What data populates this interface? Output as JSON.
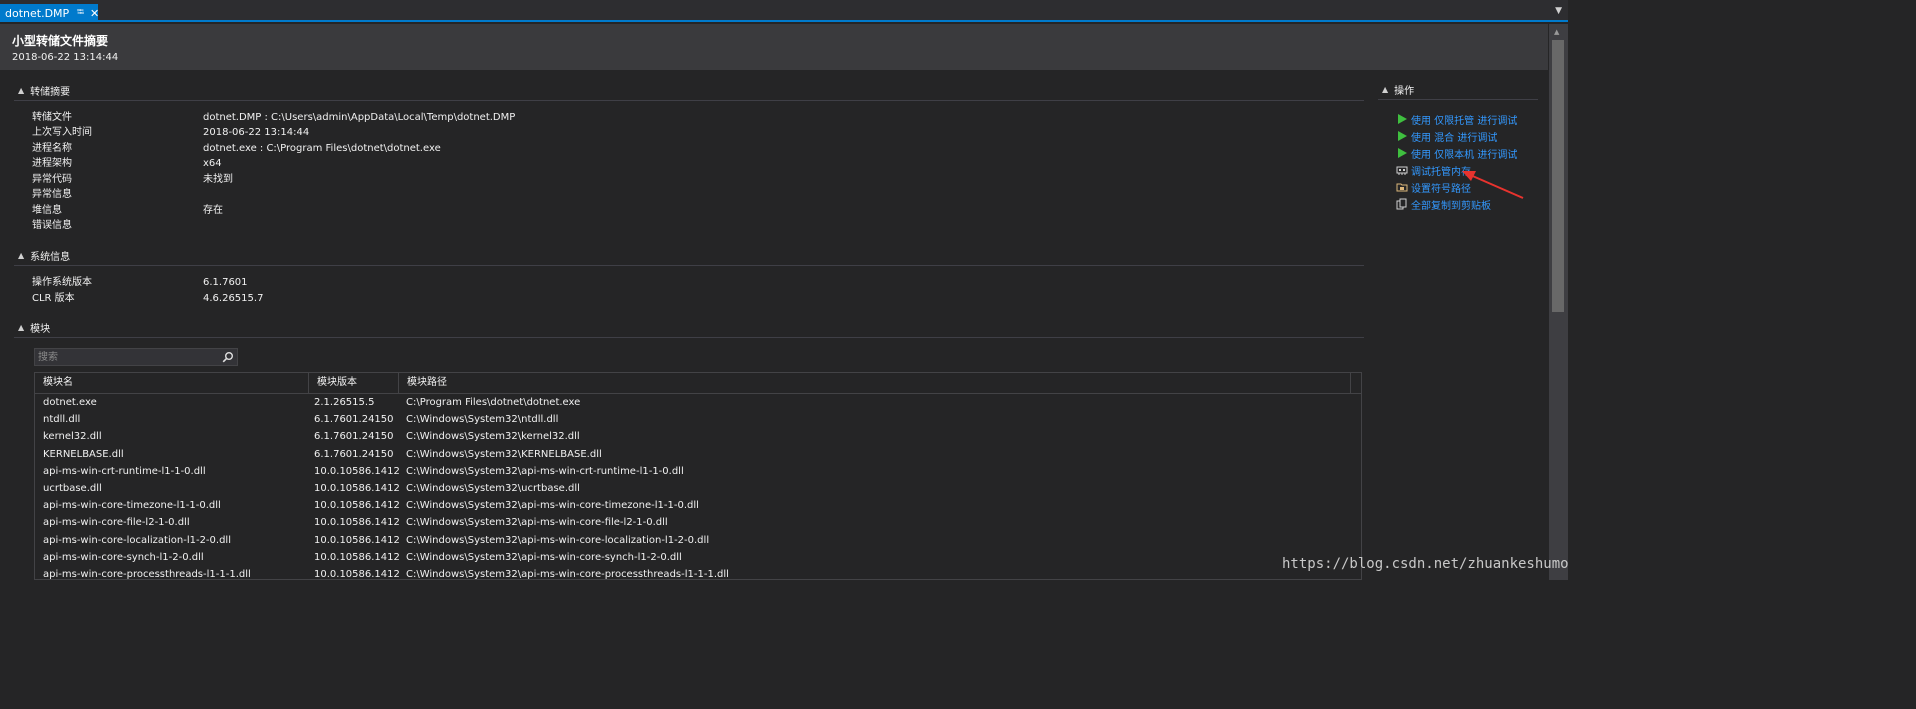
{
  "tab": {
    "label": "dotnet.DMP",
    "pin": "⭾",
    "close": "✕"
  },
  "header": {
    "title": "小型转储文件摘要",
    "date": "2018-06-22 13:14:44"
  },
  "dump_summary": {
    "heading": "转储摘要",
    "rows": [
      {
        "label": "转储文件",
        "value": "dotnet.DMP : C:\\Users\\admin\\AppData\\Local\\Temp\\dotnet.DMP"
      },
      {
        "label": "上次写入时间",
        "value": "2018-06-22 13:14:44"
      },
      {
        "label": "进程名称",
        "value": "dotnet.exe : C:\\Program Files\\dotnet\\dotnet.exe"
      },
      {
        "label": "进程架构",
        "value": "x64"
      },
      {
        "label": "异常代码",
        "value": "未找到"
      },
      {
        "label": "异常信息",
        "value": ""
      },
      {
        "label": "堆信息",
        "value": "存在"
      },
      {
        "label": "错误信息",
        "value": ""
      }
    ]
  },
  "system_info": {
    "heading": "系统信息",
    "rows": [
      {
        "label": "操作系统版本",
        "value": "6.1.7601"
      },
      {
        "label": "CLR 版本",
        "value": "4.6.26515.7"
      }
    ]
  },
  "modules": {
    "heading": "模块",
    "search_placeholder": "搜索",
    "columns": [
      "模块名",
      "模块版本",
      "模块路径"
    ],
    "rows": [
      {
        "name": "dotnet.exe",
        "version": "2.1.26515.5",
        "path": "C:\\Program Files\\dotnet\\dotnet.exe"
      },
      {
        "name": "ntdll.dll",
        "version": "6.1.7601.24150",
        "path": "C:\\Windows\\System32\\ntdll.dll"
      },
      {
        "name": "kernel32.dll",
        "version": "6.1.7601.24150",
        "path": "C:\\Windows\\System32\\kernel32.dll"
      },
      {
        "name": "KERNELBASE.dll",
        "version": "6.1.7601.24150",
        "path": "C:\\Windows\\System32\\KERNELBASE.dll"
      },
      {
        "name": "api-ms-win-crt-runtime-l1-1-0.dll",
        "version": "10.0.10586.1412",
        "path": "C:\\Windows\\System32\\api-ms-win-crt-runtime-l1-1-0.dll"
      },
      {
        "name": "ucrtbase.dll",
        "version": "10.0.10586.1412",
        "path": "C:\\Windows\\System32\\ucrtbase.dll"
      },
      {
        "name": "api-ms-win-core-timezone-l1-1-0.dll",
        "version": "10.0.10586.1412",
        "path": "C:\\Windows\\System32\\api-ms-win-core-timezone-l1-1-0.dll"
      },
      {
        "name": "api-ms-win-core-file-l2-1-0.dll",
        "version": "10.0.10586.1412",
        "path": "C:\\Windows\\System32\\api-ms-win-core-file-l2-1-0.dll"
      },
      {
        "name": "api-ms-win-core-localization-l1-2-0.dll",
        "version": "10.0.10586.1412",
        "path": "C:\\Windows\\System32\\api-ms-win-core-localization-l1-2-0.dll"
      },
      {
        "name": "api-ms-win-core-synch-l1-2-0.dll",
        "version": "10.0.10586.1412",
        "path": "C:\\Windows\\System32\\api-ms-win-core-synch-l1-2-0.dll"
      },
      {
        "name": "api-ms-win-core-processthreads-l1-1-1.dll",
        "version": "10.0.10586.1412",
        "path": "C:\\Windows\\System32\\api-ms-win-core-processthreads-l1-1-1.dll"
      }
    ]
  },
  "actions": {
    "heading": "操作",
    "items": [
      {
        "label": "使用 仅限托管 进行调试",
        "icon": "play-icon"
      },
      {
        "label": "使用 混合 进行调试",
        "icon": "play-icon"
      },
      {
        "label": "使用 仅限本机 进行调试",
        "icon": "play-icon"
      },
      {
        "label": "调试托管内存",
        "icon": "memory-icon"
      },
      {
        "label": "设置符号路径",
        "icon": "folder-icon"
      },
      {
        "label": "全部复制到剪贴板",
        "icon": "copy-icon"
      }
    ]
  },
  "watermark": "https://blog.csdn.net/zhuankeshumo",
  "colors": {
    "accent": "#007acc",
    "link": "#3399ff",
    "play": "#3fbf3f",
    "arrow": "#e8332e"
  }
}
